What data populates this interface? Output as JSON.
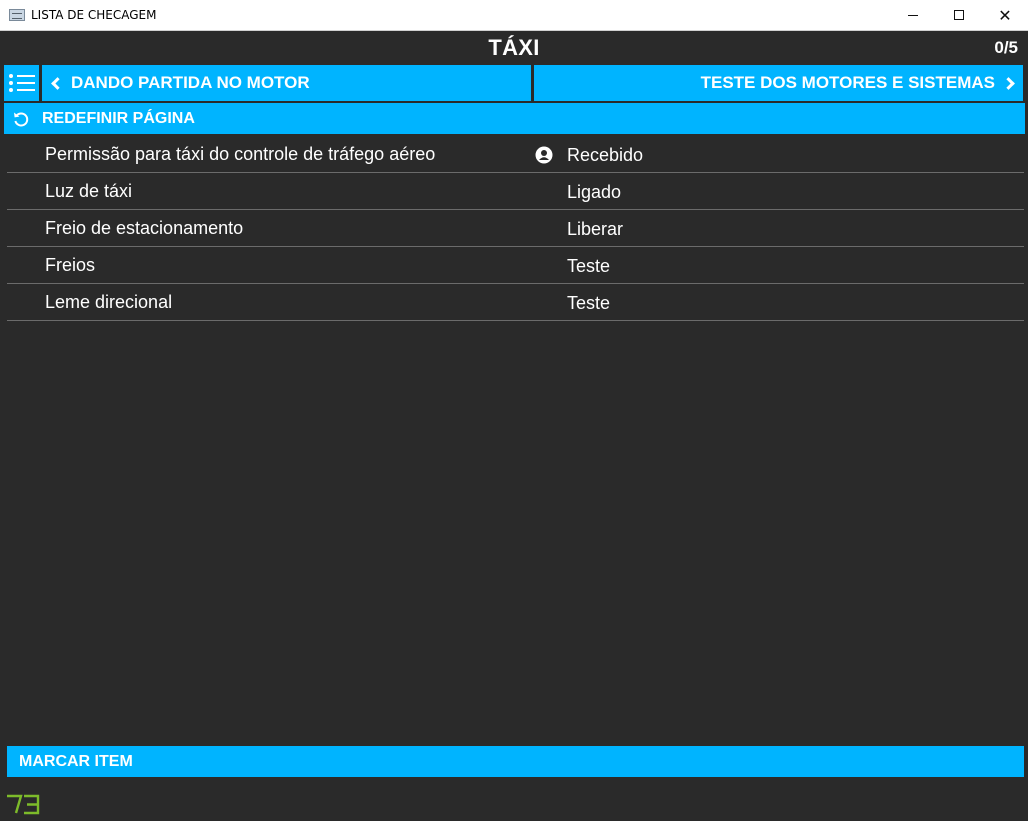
{
  "window": {
    "title": "LISTA DE CHECAGEM",
    "icon": "checklist-app-icon",
    "controls": [
      "minimize-icon",
      "maximize-icon",
      "close-icon"
    ]
  },
  "page": {
    "title": "TÁXI",
    "counter": "0/5"
  },
  "navigation": {
    "menu_icon": "list-icon",
    "prev_label": "DANDO PARTIDA NO MOTOR",
    "next_label": "TESTE DOS MOTORES E SISTEMAS"
  },
  "reset": {
    "label": "REDEFINIR PÁGINA",
    "icon": "reset-icon"
  },
  "checklist": {
    "items": [
      {
        "label": "Permissão para táxi do controle de tráfego aéreo",
        "value": "Recebido",
        "icon": "user-icon"
      },
      {
        "label": "Luz de táxi",
        "value": "Ligado"
      },
      {
        "label": "Freio de estacionamento",
        "value": "Liberar"
      },
      {
        "label": "Freios",
        "value": "Teste"
      },
      {
        "label": "Leme direcional",
        "value": "Teste"
      }
    ]
  },
  "actions": {
    "mark_item_label": "MARCAR ITEM"
  },
  "colors": {
    "accent": "#00b4ff",
    "background": "#2a2a2a",
    "divider": "#6b6b6b",
    "logo": "#7dbb2a"
  }
}
